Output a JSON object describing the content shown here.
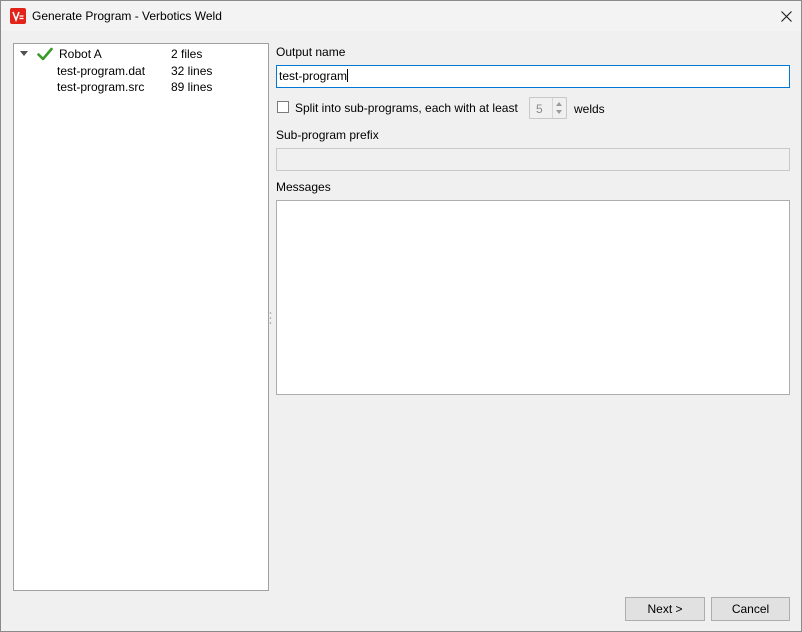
{
  "window": {
    "title": "Generate Program - Verbotics Weld",
    "app_icon": "verbotics-logo-icon",
    "close_icon": "close-icon"
  },
  "tree": {
    "robot": {
      "name": "Robot A",
      "meta": "2 files",
      "status_icon": "green-check-icon",
      "expanded": true
    },
    "files": [
      {
        "name": "test-program.dat",
        "meta": "32 lines"
      },
      {
        "name": "test-program.src",
        "meta": "89 lines"
      }
    ]
  },
  "form": {
    "output_name_label": "Output name",
    "output_name_value": "test-program",
    "split_label": "Split into sub-programs, each with at least",
    "split_checked": false,
    "split_count": "5",
    "split_unit": "welds",
    "prefix_label": "Sub-program prefix",
    "prefix_value": "",
    "messages_label": "Messages",
    "messages_text": ""
  },
  "buttons": {
    "next_label": "Next >",
    "cancel_label": "Cancel"
  }
}
